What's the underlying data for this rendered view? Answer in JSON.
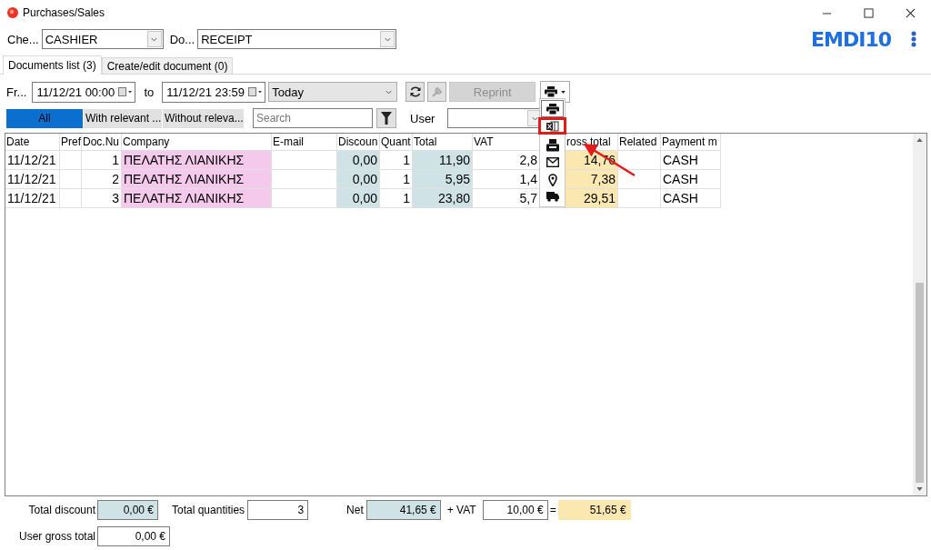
{
  "window": {
    "title": "Purchases/Sales"
  },
  "header": {
    "cashier": {
      "label": "Che...",
      "value": "CASHIER"
    },
    "document": {
      "label": "Do...",
      "value": "RECEIPT"
    },
    "logo": "EMDI10"
  },
  "tabs": [
    {
      "label": "Documents list (3)",
      "selected": true
    },
    {
      "label": "Create/edit document (0)",
      "selected": false
    }
  ],
  "filters": {
    "from_label": "Fr...",
    "from": "11/12/21 00:00",
    "to_label": "to",
    "to": "11/12/21 23:59",
    "period": "Today",
    "reprint": {
      "label": "Reprint",
      "disabled": true
    }
  },
  "segments": [
    {
      "label": "All",
      "selected": true
    },
    {
      "label": "With relevant ...",
      "selected": false
    },
    {
      "label": "Without releva...",
      "selected": false
    }
  ],
  "search": {
    "placeholder": "Search"
  },
  "user_filter": {
    "label": "User"
  },
  "table": {
    "columns": [
      "Date",
      "Pref",
      "Doc.Nu",
      "Company",
      "E-mail",
      "Discoun",
      "Quant",
      "Total",
      "VAT",
      "ross total",
      "Related",
      "Payment m"
    ],
    "rows": [
      {
        "cells": [
          "11/12/21",
          "",
          "1",
          "ΠΕΛΑΤΗΣ ΛΙΑΝΙΚΗΣ",
          "",
          "0,00",
          "1",
          "11,90",
          "2,8",
          "14,76",
          "",
          "CASH"
        ]
      },
      {
        "cells": [
          "11/12/21",
          "",
          "2",
          "ΠΕΛΑΤΗΣ ΛΙΑΝΙΚΗΣ",
          "",
          "0,00",
          "1",
          "5,95",
          "1,4",
          "7,38",
          "",
          "CASH"
        ]
      },
      {
        "cells": [
          "11/12/21",
          "",
          "3",
          "ΠΕΛΑΤΗΣ ΛΙΑΝΙΚΗΣ",
          "",
          "0,00",
          "1",
          "23,80",
          "5,7",
          "29,51",
          "",
          "CASH"
        ]
      }
    ]
  },
  "print_menu": {
    "items": [
      {
        "kind": "printer",
        "highlighted": false
      },
      {
        "kind": "excel",
        "highlighted": true
      },
      {
        "kind": "fax",
        "highlighted": false
      },
      {
        "kind": "mail",
        "highlighted": false
      },
      {
        "kind": "location",
        "highlighted": false
      },
      {
        "kind": "truck",
        "highlighted": false
      }
    ]
  },
  "summary": {
    "total_discount": {
      "label": "Total discount",
      "value": "0,00 €"
    },
    "total_quantities": {
      "label": "Total quantities",
      "value": "3"
    },
    "net": {
      "label": "Net",
      "value": "41,65 €"
    },
    "vat": {
      "label": "+ VAT",
      "value": "10,00 €"
    },
    "equals": "=",
    "gross": {
      "value": "51,65 €"
    },
    "user_gross_total": {
      "label": "User gross total",
      "value": "0,00 €"
    }
  }
}
